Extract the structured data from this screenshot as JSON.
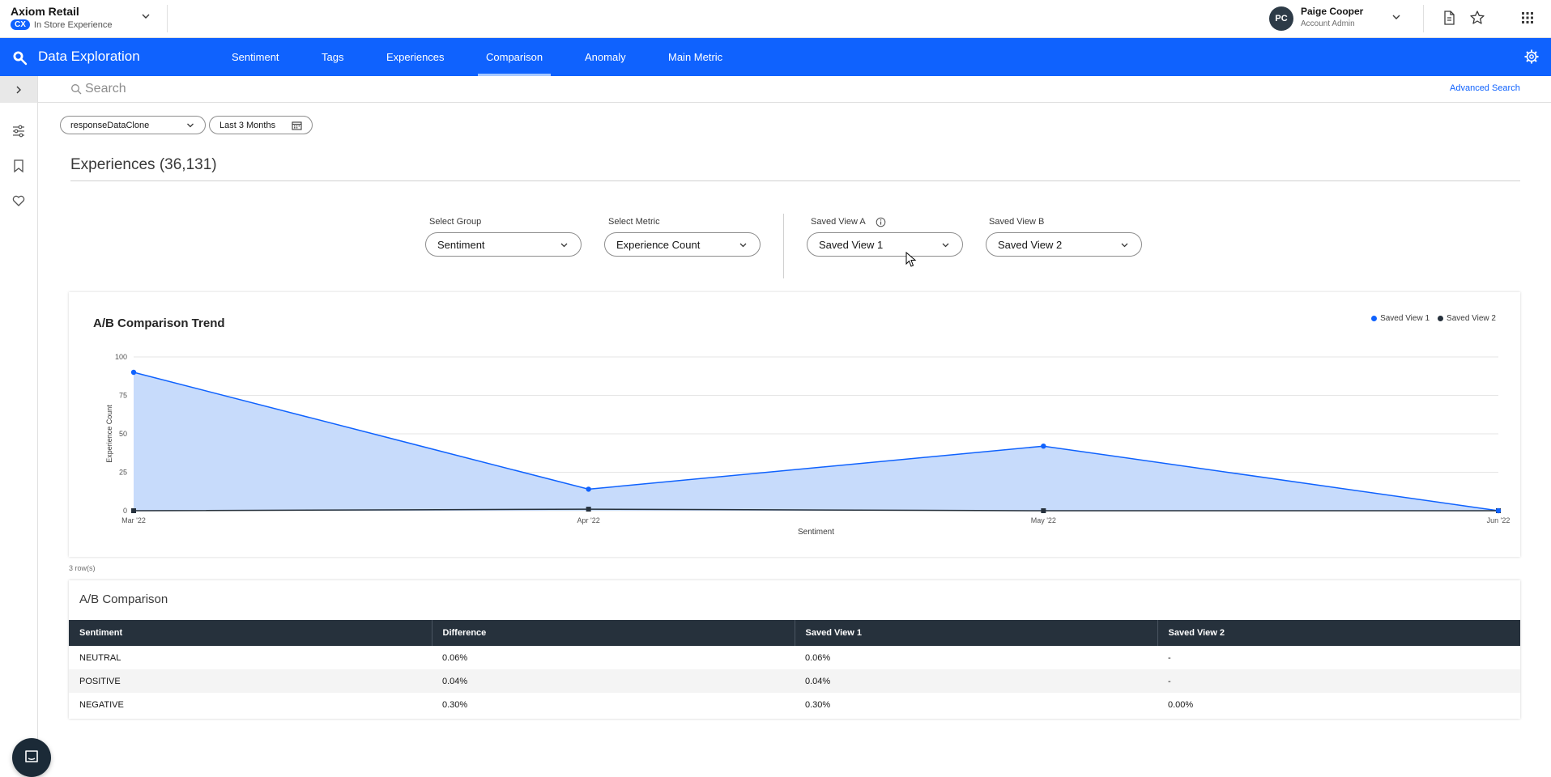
{
  "header": {
    "brand_name": "Axiom Retail",
    "brand_badge": "CX",
    "brand_sub": "In Store Experience",
    "user_initials": "PC",
    "user_name": "Paige Cooper",
    "user_role": "Account Admin"
  },
  "nav": {
    "title": "Data Exploration",
    "tabs": [
      {
        "label": "Sentiment"
      },
      {
        "label": "Tags"
      },
      {
        "label": "Experiences"
      },
      {
        "label": "Comparison",
        "active": true
      },
      {
        "label": "Anomaly"
      },
      {
        "label": "Main Metric"
      }
    ]
  },
  "search": {
    "placeholder": "Search",
    "advanced_label": "Advanced Search"
  },
  "filters": {
    "dataset": "responseDataClone",
    "date_range": "Last 3 Months"
  },
  "experiences": {
    "title": "Experiences (36,131)"
  },
  "selects": {
    "group_label": "Select Group",
    "group_value": "Sentiment",
    "metric_label": "Select Metric",
    "metric_value": "Experience Count",
    "view_a_label": "Saved View A",
    "view_a_value": "Saved View 1",
    "view_b_label": "Saved View B",
    "view_b_value": "Saved View 2"
  },
  "colors": {
    "accent": "#0f62fe",
    "series_a": "#0f62fe",
    "series_a_fill": "#c7dbfb",
    "series_b": "#26313c"
  },
  "chart_data": {
    "type": "area",
    "title": "A/B Comparison Trend",
    "xlabel": "Sentiment",
    "ylabel": "Experience Count",
    "categories": [
      "Mar '22",
      "Apr '22",
      "May '22",
      "Jun '22"
    ],
    "ylim": [
      0,
      100
    ],
    "yticks": [
      0,
      25,
      50,
      75,
      100
    ],
    "grid": true,
    "legend_position": "top-right",
    "series": [
      {
        "name": "Saved View 1",
        "values": [
          90,
          14,
          42,
          0
        ]
      },
      {
        "name": "Saved View 2",
        "values": [
          0,
          1,
          0,
          0
        ]
      }
    ]
  },
  "table": {
    "row_count": "3 row(s)",
    "title": "A/B Comparison",
    "columns": [
      "Sentiment",
      "Difference",
      "Saved View 1",
      "Saved View 2"
    ],
    "rows": [
      [
        "NEUTRAL",
        "0.06%",
        "0.06%",
        "-"
      ],
      [
        "POSITIVE",
        "0.04%",
        "0.04%",
        "-"
      ],
      [
        "NEGATIVE",
        "0.30%",
        "0.30%",
        "0.00%"
      ]
    ]
  }
}
